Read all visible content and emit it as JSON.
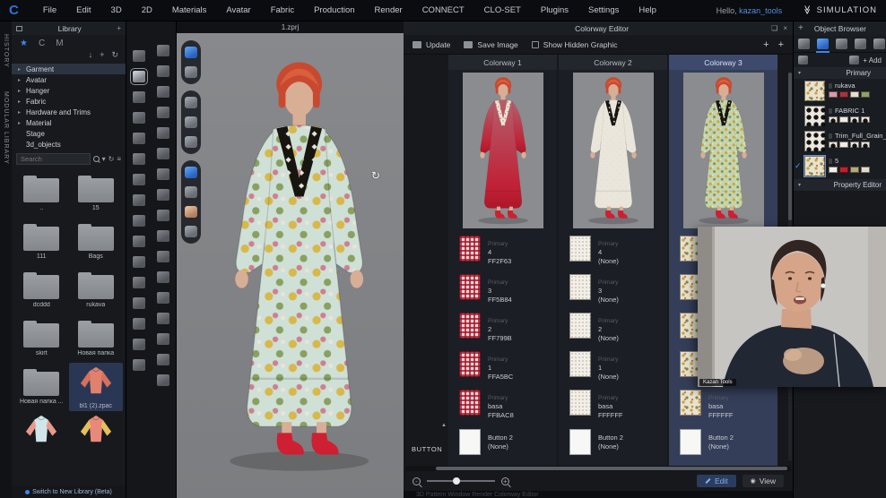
{
  "menu_bar": {
    "logo": "C",
    "items": [
      "File",
      "Edit",
      "3D",
      "2D",
      "Materials",
      "Avatar",
      "Fabric",
      "Production",
      "Render",
      "CONNECT",
      "CLO-SET",
      "Plugins",
      "Settings",
      "Help"
    ],
    "greeting": "Hello,",
    "username": "kazan_tools",
    "brand": "SIMULATION"
  },
  "side_strip": {
    "tabs": [
      "HISTORY",
      "MODULAR LIBRARY"
    ]
  },
  "library": {
    "title": "Library",
    "tabs": [
      "favorites-star",
      "clo",
      "md"
    ],
    "tree": [
      {
        "label": "Garment",
        "arrow": true,
        "selected": true
      },
      {
        "label": "Avatar",
        "arrow": true,
        "selected": false
      },
      {
        "label": "Hanger",
        "arrow": true,
        "selected": false
      },
      {
        "label": "Fabric",
        "arrow": true,
        "selected": false
      },
      {
        "label": "Hardware and Trims",
        "arrow": true,
        "selected": false
      },
      {
        "label": "Material",
        "arrow": true,
        "selected": false
      },
      {
        "label": "Stage",
        "arrow": false,
        "selected": false
      },
      {
        "label": "3d_objects",
        "arrow": false,
        "selected": false
      }
    ],
    "search_placeholder": "Search",
    "items": [
      {
        "label": "..",
        "type": "folder",
        "selected": false
      },
      {
        "label": "15",
        "type": "folder",
        "selected": false
      },
      {
        "label": "111",
        "type": "folder",
        "selected": false
      },
      {
        "label": "Bags",
        "type": "folder",
        "selected": false
      },
      {
        "label": "dcddd",
        "type": "folder",
        "selected": false
      },
      {
        "label": "rukava",
        "type": "folder",
        "selected": false
      },
      {
        "label": "skirt",
        "type": "folder",
        "selected": false
      },
      {
        "label": "Новая папка",
        "type": "folder",
        "selected": false
      },
      {
        "label": "Новая папка ...",
        "type": "folder",
        "selected": false
      },
      {
        "label": "bl1 (2).zpac",
        "type": "garment-pink",
        "selected": true
      },
      {
        "label": "",
        "type": "garment-blue",
        "selected": false
      },
      {
        "label": "",
        "type": "garment-orange",
        "selected": false
      }
    ],
    "switch_link": "Switch to New Library (Beta)"
  },
  "tool_columns": {
    "a": [
      "import",
      "transform",
      "pen",
      "brush",
      "avatar",
      "sewing-machine",
      "steamer",
      "kettle",
      "fold",
      "tops",
      "jacket",
      "pants",
      "skirt",
      "shoes",
      "hat",
      "accessory"
    ],
    "a_selected_index": 1,
    "b": [
      "run-pose",
      "pose-1",
      "pose-2",
      "pose-3",
      "pose-4",
      "pose-5",
      "pose-6",
      "pose-7",
      "pose-8",
      "texture",
      "texture-2",
      "swatch",
      "swatch-2",
      "pattern",
      "pattern-2",
      "trim",
      "trim-2"
    ]
  },
  "viewport": {
    "tab": "1.zprj",
    "pill_groups": [
      [
        "gem",
        "avatar"
      ],
      [
        "garment",
        "pin",
        "model"
      ],
      [
        "fabric",
        "flat",
        "face",
        "globe"
      ]
    ]
  },
  "colorway_editor": {
    "title": "Colorway Editor",
    "toolbar": {
      "update": "Update",
      "save_image": "Save Image",
      "show_hidden": "Show Hidden Graphic"
    },
    "row_group_label": "BUTTON",
    "columns": [
      {
        "name": "Colorway 1",
        "selected": false,
        "texture": "plaid-red",
        "avatar": "red",
        "swatches": [
          {
            "label": "Primary",
            "name": "4",
            "value": "FF2F63"
          },
          {
            "label": "Primary",
            "name": "3",
            "value": "FF5B84"
          },
          {
            "label": "Primary",
            "name": "2",
            "value": "FF799B"
          },
          {
            "label": "Primary",
            "name": "1",
            "value": "FFA5BC"
          },
          {
            "label": "Primary",
            "name": "basa",
            "value": "FFBAC8"
          }
        ],
        "button": {
          "name": "Button 2",
          "value": "(None)"
        }
      },
      {
        "name": "Colorway 2",
        "selected": false,
        "texture": "dot-cream",
        "avatar": "cream",
        "swatches": [
          {
            "label": "Primary",
            "name": "4",
            "value": "(None)"
          },
          {
            "label": "Primary",
            "name": "3",
            "value": "(None)"
          },
          {
            "label": "Primary",
            "name": "2",
            "value": "(None)"
          },
          {
            "label": "Primary",
            "name": "1",
            "value": "(None)"
          },
          {
            "label": "Primary",
            "name": "basa",
            "value": "FFFFFF"
          }
        ],
        "button": {
          "name": "Button 2",
          "value": "(None)"
        }
      },
      {
        "name": "Colorway 3",
        "selected": true,
        "texture": "floral",
        "avatar": "floral-green",
        "swatches": [
          {
            "label": "",
            "name": "",
            "value": ""
          },
          {
            "label": "",
            "name": "",
            "value": ""
          },
          {
            "label": "",
            "name": "",
            "value": ""
          },
          {
            "label": "",
            "name": "",
            "value": ""
          },
          {
            "label": "Primary",
            "name": "basa",
            "value": "FFFFFF"
          }
        ],
        "button": {
          "name": "Button 2",
          "value": "(None)"
        }
      }
    ],
    "footer": {
      "edit": "Edit",
      "view": "View"
    },
    "bottom_tabs": "3D Pattern Window      Render      Colorway Editor"
  },
  "object_browser": {
    "title": "Object Browser",
    "add_label": "+ Add",
    "section": "Primary",
    "items": [
      {
        "name": "rukava",
        "texture": "floral",
        "selected": false,
        "chips": [
          "#d89ca4",
          "#a83240",
          "#e6ded2",
          "#93a06b"
        ]
      },
      {
        "name": "FABRIC 1",
        "texture": "bw",
        "selected": false,
        "chips": [
          "bw",
          "#f0ece4",
          "bw",
          "bw"
        ]
      },
      {
        "name": "Trim_Full_Grain_L",
        "texture": "bw",
        "selected": false,
        "chips": [
          "bw",
          "#f0ece4",
          "bw",
          "bw"
        ]
      },
      {
        "name": "5",
        "texture": "floral",
        "selected": true,
        "chips": [
          "#f2f0ea",
          "#c02030",
          "#b8a878",
          "#e2ddca"
        ]
      }
    ],
    "property_section": "Property Editor"
  },
  "webcam": {
    "label": "Kazan Tools"
  },
  "icons": {
    "close": "×",
    "float": "❏",
    "caret_down": "▾",
    "arrow_down": "↓",
    "refresh": "↻",
    "plus": "+",
    "list": "≡",
    "check": "✓",
    "rotate_cursor": "↻",
    "marker_up": "▲",
    "wing": "≫"
  }
}
